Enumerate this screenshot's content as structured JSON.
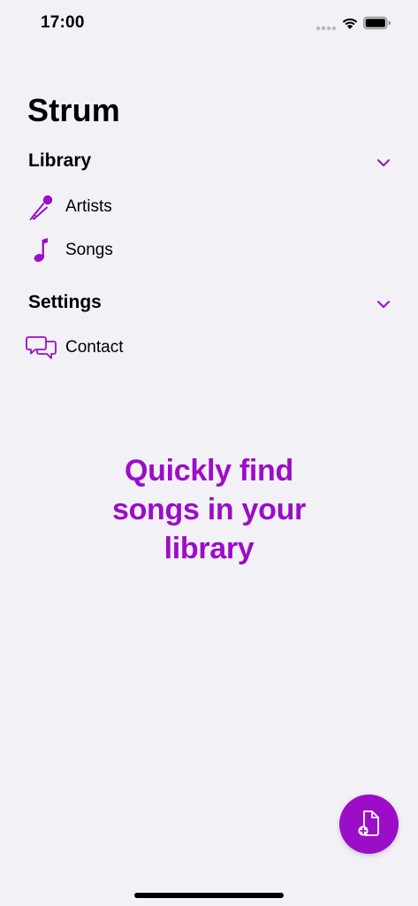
{
  "status_bar": {
    "time": "17:00"
  },
  "app": {
    "title": "Strum"
  },
  "sections": {
    "library": {
      "title": "Library",
      "items": [
        {
          "label": "Artists",
          "icon": "microphone-icon"
        },
        {
          "label": "Songs",
          "icon": "music-note-icon"
        }
      ]
    },
    "settings": {
      "title": "Settings",
      "items": [
        {
          "label": "Contact",
          "icon": "chat-bubbles-icon"
        }
      ]
    }
  },
  "tagline": "Quickly find songs in  your library",
  "fab": {
    "icon": "add-document-icon"
  },
  "colors": {
    "accent": "#9c0dc7",
    "background": "#f2f1f6",
    "text": "#000000"
  }
}
